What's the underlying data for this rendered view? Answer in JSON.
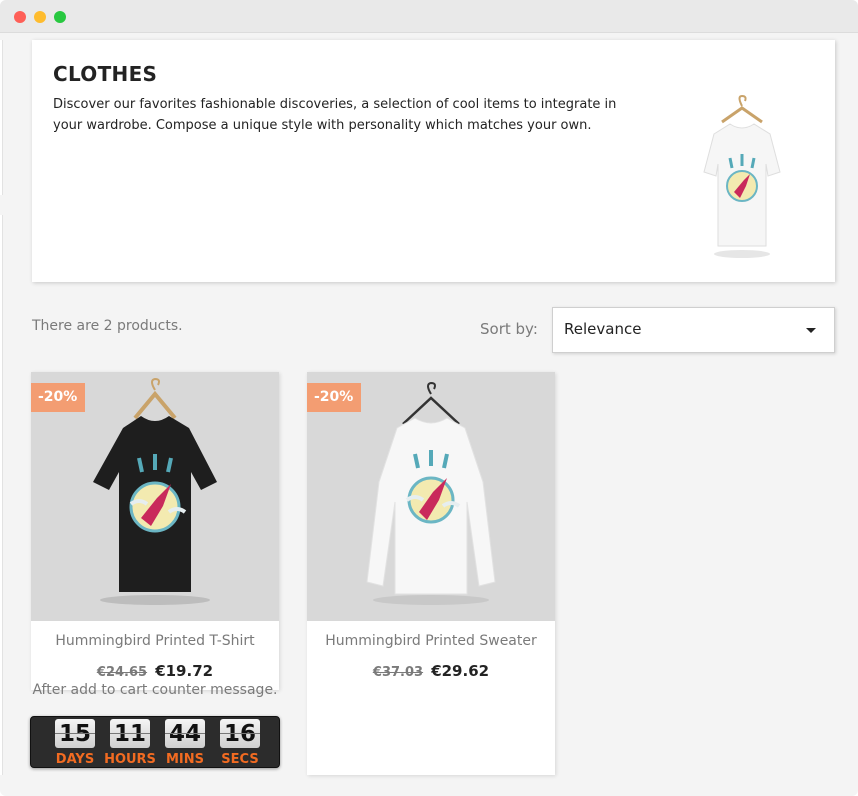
{
  "category": {
    "title": "CLOTHES",
    "description": "Discover our favorites fashionable discoveries, a selection of cool items to integrate in your wardrobe. Compose a unique style with personality which matches your own."
  },
  "listing": {
    "count_text": "There are 2 products.",
    "sort_label": "Sort by:",
    "sort_value": "Relevance"
  },
  "products": [
    {
      "discount": "-20%",
      "name": "Hummingbird Printed T-Shirt",
      "old_price": "€24.65",
      "price": "€19.72",
      "cart_message": "After add to cart counter message.",
      "shirt_color": "#1e1e1e"
    },
    {
      "discount": "-20%",
      "name": "Hummingbird Printed Sweater",
      "old_price": "€37.03",
      "price": "€29.62",
      "shirt_color": "#f7f7f7"
    }
  ],
  "countdown": {
    "days": "15",
    "days_label": "DAYS",
    "hours": "11",
    "hours_label": "HOURS",
    "mins": "44",
    "mins_label": "MINS",
    "secs": "16",
    "secs_label": "SECS"
  },
  "colors": {
    "discount_badge": "#f39d72",
    "countdown_label": "#f26b21"
  }
}
